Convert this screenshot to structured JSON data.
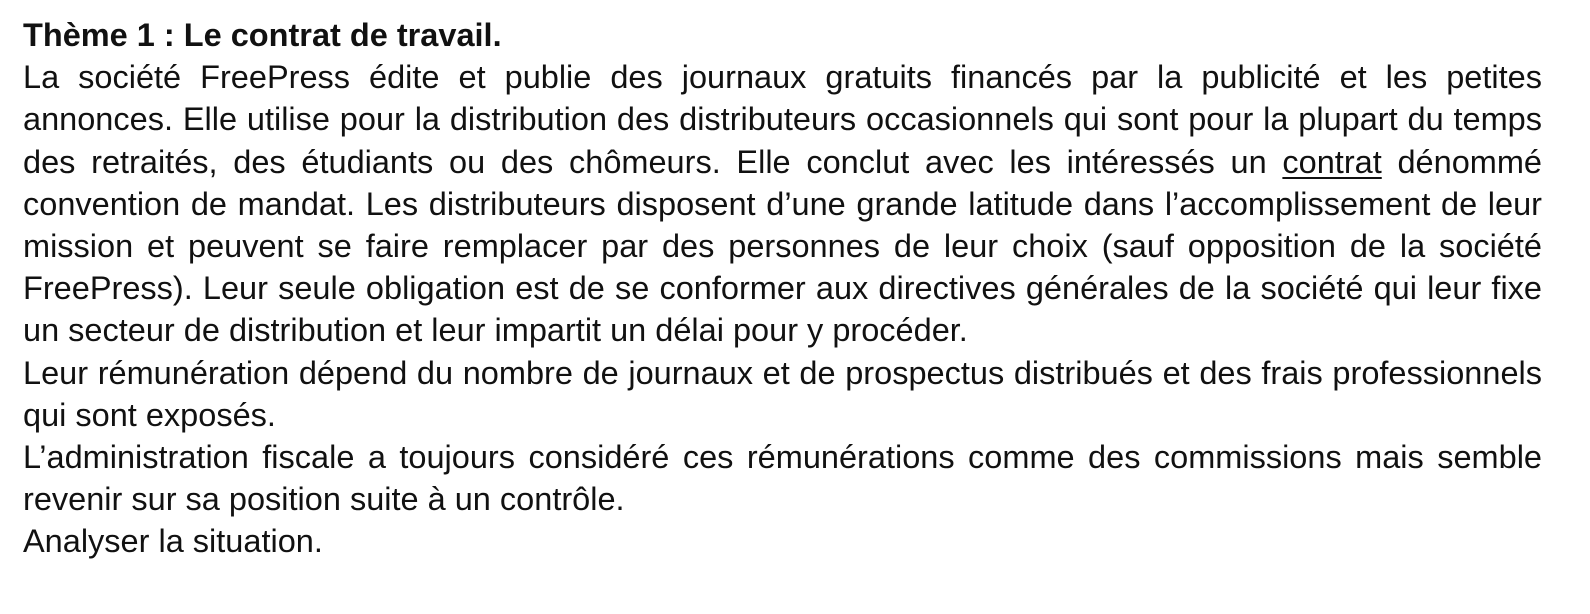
{
  "document": {
    "title": "Thème 1 : Le contrat de travail.",
    "paragraph1": {
      "before_underline": "La société FreePress édite et publie des journaux gratuits financés par la publicité et les petites annonces. Elle utilise pour la distribution des distributeurs occasionnels qui sont pour la plupart du temps des retraités, des étudiants ou des chômeurs. Elle conclut avec les intéressés un ",
      "underlined_word": "contrat",
      "after_underline": " dénommé convention de mandat. Les distributeurs disposent d’une grande latitude dans l’accomplissement de leur mission et peuvent se faire remplacer par des personnes de leur choix (sauf opposition de la société FreePress). Leur seule obligation est de se conformer aux directives générales de la société qui leur fixe un secteur de distribution et leur impartit un délai pour y procéder."
    },
    "paragraph2": "Leur rémunération dépend du nombre de journaux et de prospectus distribués et des frais professionnels qui sont exposés.",
    "paragraph3": "L’administration fiscale a toujours considéré ces rémunérations comme des commissions mais semble revenir sur sa position suite à un contrôle.",
    "instruction": "Analyser la situation."
  }
}
